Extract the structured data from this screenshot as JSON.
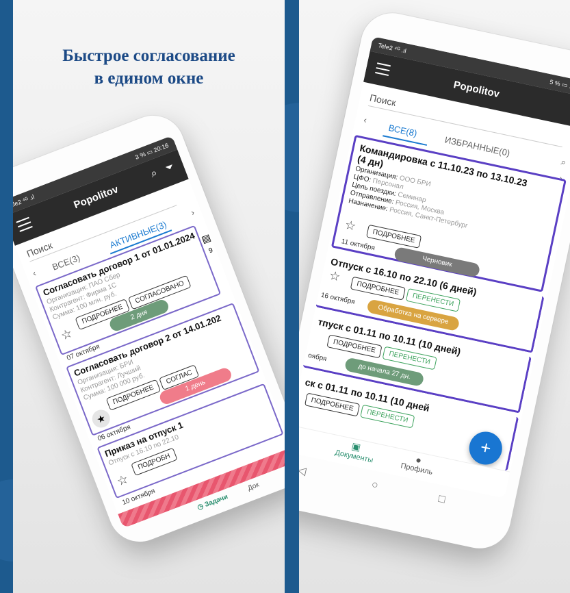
{
  "headline": {
    "line1": "Быстрое согласование",
    "line2": "в едином окне"
  },
  "left_phone": {
    "status_left": "Tele2 ⁴ᴳ .ıl",
    "status_right": "3 % ▭ 20:16",
    "app_title": "Popolitov",
    "search_placeholder": "Поиск",
    "tabs": [
      "ВСЕ(3)",
      "АКТИВНЫЕ(3)"
    ],
    "cards": [
      {
        "title": "Согласовать договор 1 от 01.01.2024",
        "lines": [
          "Организация: ПАО Сбер",
          "Контрагент: Фирма 1С",
          "Сумма: 100 млн. руб."
        ],
        "btn1": "ПОДРОБНЕЕ",
        "btn2": "СОГЛАСОВАНО",
        "pill": "2 дня",
        "date": "07 октября"
      },
      {
        "title": "Согласовать договор 2 от 14.01.202",
        "lines": [
          "Организация: БРИ",
          "Контрагент: Лучший",
          "Сумма: 100 000 руб."
        ],
        "btn1": "ПОДРОБНЕЕ",
        "btn2": "СОГЛАС",
        "pill": "1 день",
        "date": "06 октября"
      },
      {
        "title": "Приказ на отпуск 1",
        "lines": [
          "Отпуск с 16.10 по 22.10"
        ],
        "btn1": "ПОДРОБН",
        "date": "10 октября"
      }
    ],
    "nav_label": "Задачи",
    "nav_label2": "Док",
    "side_count": "9",
    "colors": {
      "green_pill": "#6e9c7a",
      "red_pill": "#f07c8a"
    }
  },
  "right_phone": {
    "status_left": "Tele2 ⁴ᴳ .ıl",
    "status_right": "5 % ▭ 19:45",
    "app_title": "Popolitov",
    "search_placeholder": "Поиск",
    "tabs": [
      "ВСЕ(8)",
      "ИЗБРАННЫЕ(0)"
    ],
    "cards": [
      {
        "title1": "Командировка с 11.10.23 по 13.10.23",
        "title2": "(4 дн)",
        "lines": [
          {
            "k": "Организация:",
            "v": "ООО БРИ"
          },
          {
            "k": "ЦФО:",
            "v": "Персонал"
          },
          {
            "k": "Цель поездки:",
            "v": "Семинар"
          },
          {
            "k": "Отправление:",
            "v": "Россия, Москва"
          },
          {
            "k": "Назначение:",
            "v": "Россия, Санкт-Петербург"
          }
        ],
        "btn1": "ПОДРОБНЕЕ",
        "date": "11 октября",
        "pill": "Черновик"
      },
      {
        "title": "Отпуск с 16.10 по 22.10 (6 дней)",
        "btn1": "ПОДРОБНЕЕ",
        "btn2": "ПЕРЕНЕСТИ",
        "date": "16 октября",
        "pill": "Обработка на сервере"
      },
      {
        "title": "тпуск с 01.11 по 10.11 (10 дней)",
        "btn1": "ПОДРОБНЕЕ",
        "btn2": "ПЕРЕНЕСТИ",
        "date": "оября",
        "pill": "до начала 27 дн."
      },
      {
        "title": "ск с 01.11 по 10.11 (10 дней",
        "btn1": "ПОДРОБНЕЕ",
        "btn2": "ПЕРЕНЕСТИ"
      }
    ],
    "fab": "+",
    "nav": {
      "documents": "Документы",
      "profile": "Профиль",
      "tasks_frag": "и"
    },
    "colors": {
      "draft": "#7a7a7a",
      "server": "#d9a441",
      "start": "#6e9c7a",
      "accent": "#1976d2"
    }
  }
}
